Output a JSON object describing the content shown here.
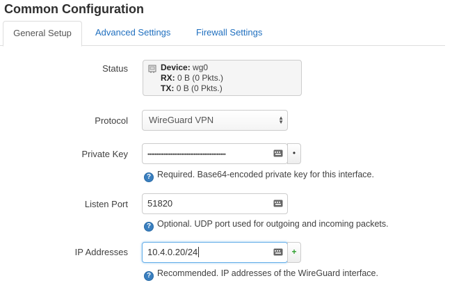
{
  "page": {
    "title": "Common Configuration"
  },
  "tabs": [
    {
      "label": "General Setup",
      "active": true
    },
    {
      "label": "Advanced Settings",
      "active": false
    },
    {
      "label": "Firewall Settings",
      "active": false
    }
  ],
  "status": {
    "label": "Status",
    "device_key": "Device:",
    "device_value": "wg0",
    "rx_key": "RX:",
    "rx_value": "0 B (0 Pkts.)",
    "tx_key": "TX:",
    "tx_value": "0 B (0 Pkts.)"
  },
  "protocol": {
    "label": "Protocol",
    "value": "WireGuard VPN"
  },
  "private_key": {
    "label": "Private Key",
    "value": "••••••••••••••••••••••••••••••••••••••••••••",
    "reveal_button": "•",
    "help": "Required. Base64-encoded private key for this interface."
  },
  "listen_port": {
    "label": "Listen Port",
    "value": "51820",
    "help": "Optional. UDP port used for outgoing and incoming packets."
  },
  "ip_addresses": {
    "label": "IP Addresses",
    "value": "10.4.0.20/24",
    "add_button": "+",
    "help": "Recommended. IP addresses of the WireGuard interface."
  },
  "icons": {
    "help": "question-circle-icon",
    "keyboard": "keyboard-icon",
    "device": "ethernet-port-icon"
  },
  "colors": {
    "link": "#1f6fbf",
    "help_icon": "#3a7fbf",
    "add": "#2ea02e",
    "focus": "#66afe9"
  }
}
